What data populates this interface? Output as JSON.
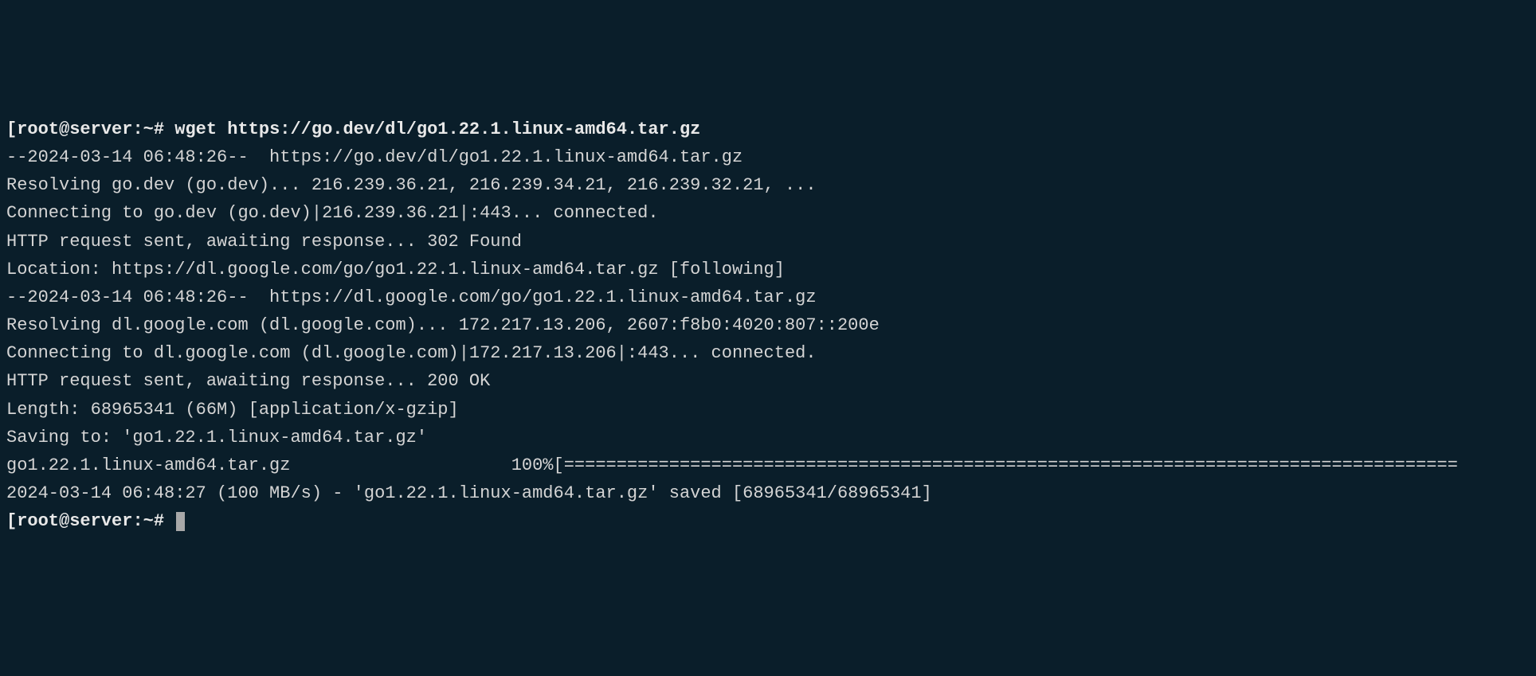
{
  "prompt1": {
    "bracket_open": "[",
    "user_host": "root@server",
    "path": ":~",
    "symbol": "# ",
    "command": "wget https://go.dev/dl/go1.22.1.linux-amd64.tar.gz"
  },
  "output": {
    "line1": "--2024-03-14 06:48:26--  https://go.dev/dl/go1.22.1.linux-amd64.tar.gz",
    "line2": "Resolving go.dev (go.dev)... 216.239.36.21, 216.239.34.21, 216.239.32.21, ...",
    "line3": "Connecting to go.dev (go.dev)|216.239.36.21|:443... connected.",
    "line4": "HTTP request sent, awaiting response... 302 Found",
    "line5": "Location: https://dl.google.com/go/go1.22.1.linux-amd64.tar.gz [following]",
    "line6": "--2024-03-14 06:48:26--  https://dl.google.com/go/go1.22.1.linux-amd64.tar.gz",
    "line7": "Resolving dl.google.com (dl.google.com)... 172.217.13.206, 2607:f8b0:4020:807::200e",
    "line8": "Connecting to dl.google.com (dl.google.com)|172.217.13.206|:443... connected.",
    "line9": "HTTP request sent, awaiting response... 200 OK",
    "line10": "Length: 68965341 (66M) [application/x-gzip]",
    "line11": "Saving to: 'go1.22.1.linux-amd64.tar.gz'",
    "blank1": "",
    "progress": "go1.22.1.linux-amd64.tar.gz                     100%[=====================================================================================",
    "blank2": "",
    "saved": "2024-03-14 06:48:27 (100 MB/s) - 'go1.22.1.linux-amd64.tar.gz' saved [68965341/68965341]",
    "blank3": ""
  },
  "prompt2": {
    "bracket_open": "[",
    "user_host": "root@server",
    "path": ":~",
    "symbol": "# "
  }
}
